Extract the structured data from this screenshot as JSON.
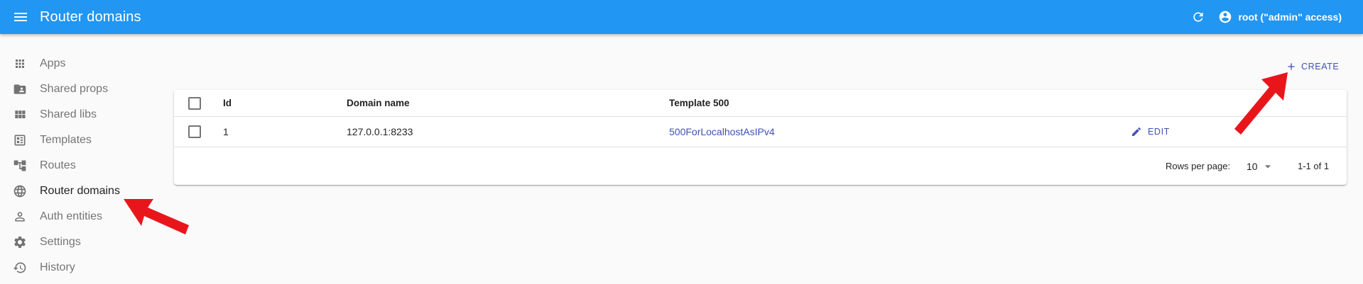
{
  "app_bar": {
    "title": "Router domains",
    "user_label": "root (\"admin\" access)",
    "background": "#2196f3"
  },
  "sidebar": {
    "items": [
      {
        "label": "Apps",
        "icon": "apps-grid-icon",
        "active": false
      },
      {
        "label": "Shared props",
        "icon": "folder-shared-icon",
        "active": false
      },
      {
        "label": "Shared libs",
        "icon": "view-module-icon",
        "active": false
      },
      {
        "label": "Templates",
        "icon": "templates-icon",
        "active": false
      },
      {
        "label": "Routes",
        "icon": "account-tree-icon",
        "active": false
      },
      {
        "label": "Router domains",
        "icon": "globe-icon",
        "active": true
      },
      {
        "label": "Auth entities",
        "icon": "person-icon",
        "active": false
      },
      {
        "label": "Settings",
        "icon": "gear-icon",
        "active": false
      },
      {
        "label": "History",
        "icon": "history-icon",
        "active": false
      }
    ]
  },
  "toolbar": {
    "create_label": "CREATE"
  },
  "table": {
    "columns": [
      "Id",
      "Domain name",
      "Template 500"
    ],
    "rows": [
      {
        "id": "1",
        "domain_name": "127.0.0.1:8233",
        "template_500": "500ForLocalhostAsIPv4",
        "edit_label": "EDIT"
      }
    ]
  },
  "pagination": {
    "rows_per_page_label": "Rows per page:",
    "rows_per_page_value": "10",
    "range_label": "1-1 of 1"
  },
  "colors": {
    "primary": "#3f51b5",
    "annotation_arrow": "#e8161b"
  }
}
